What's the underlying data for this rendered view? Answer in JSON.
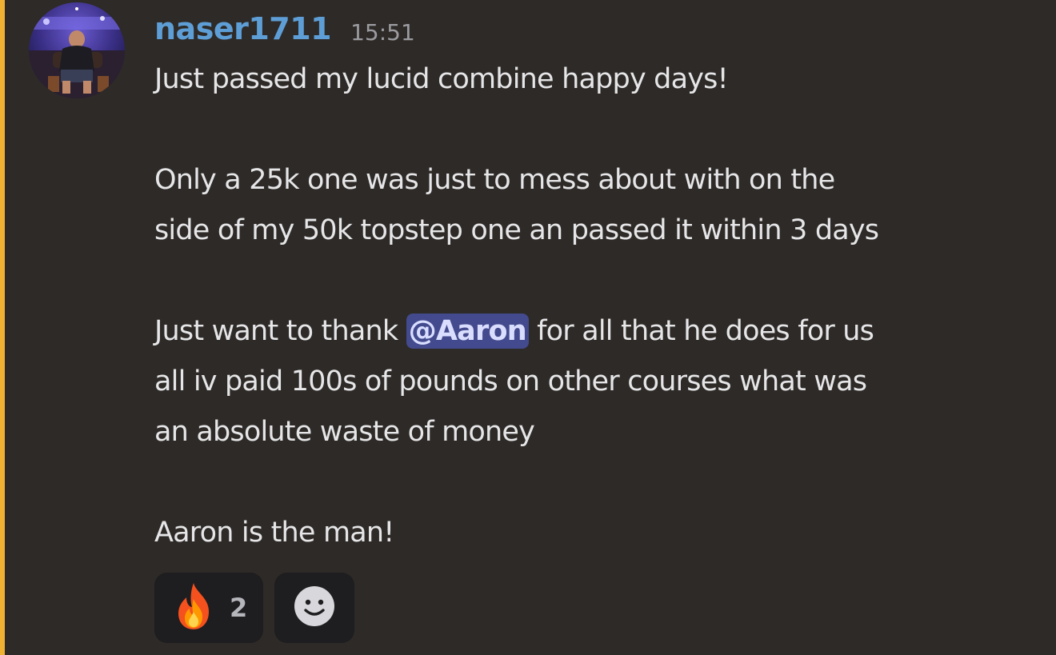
{
  "message": {
    "author": "naser1711",
    "timestamp": "15:51",
    "paragraphs": {
      "p1": "Just passed my lucid combine happy days!",
      "p2_line1": "Only a 25k one was just to mess about with on the",
      "p2_line2": "side of my 50k topstep one an passed it within 3 days",
      "p3_before": "Just want to thank ",
      "p3_mention": "@Aaron",
      "p3_after": " for all that he does for us",
      "p3_line2": "all iv paid 100s of pounds on other courses what was",
      "p3_line3": "an absolute waste of money",
      "p4": "Aaron is the man!"
    },
    "reactions": [
      {
        "emoji": "fire-icon",
        "count": "2"
      }
    ],
    "add_reaction_icon": "smiley-face-icon"
  },
  "colors": {
    "background": "#2e2a27",
    "mention_bar": "#f0b232",
    "username": "#5e9ed6",
    "mention_bg": "#434a8d",
    "reaction_bg": "#1e1d1f"
  }
}
